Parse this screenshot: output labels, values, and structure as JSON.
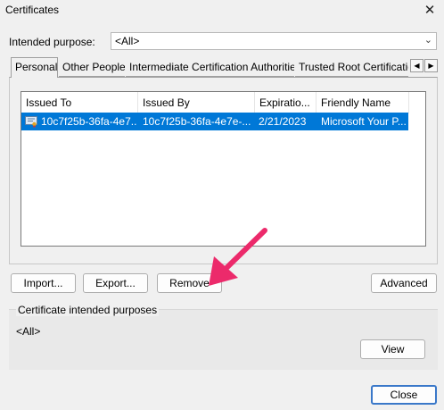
{
  "window": {
    "title": "Certificates",
    "close_glyph": "✕"
  },
  "purpose": {
    "label": "Intended purpose:",
    "value": "<All>"
  },
  "tabs": [
    {
      "label": "Personal",
      "active": true
    },
    {
      "label": "Other People",
      "active": false
    },
    {
      "label": "Intermediate Certification Authorities",
      "active": false
    },
    {
      "label": "Trusted Root Certification Authorities",
      "active": false
    }
  ],
  "table": {
    "columns": [
      "Issued To",
      "Issued By",
      "Expiratio...",
      "Friendly Name"
    ],
    "rows": [
      {
        "issued_to": "10c7f25b-36fa-4e7...",
        "issued_by": "10c7f25b-36fa-4e7e-...",
        "expiration": "2/21/2023",
        "friendly_name": "Microsoft Your P..."
      }
    ]
  },
  "buttons": {
    "import": "Import...",
    "export": "Export...",
    "remove": "Remove",
    "advanced": "Advanced",
    "view": "View",
    "close": "Close"
  },
  "purposes_group": {
    "title": "Certificate intended purposes",
    "value": "<All>"
  },
  "annotation": {
    "arrow_color": "#ec2a6b"
  },
  "colors": {
    "selection": "#0078d7",
    "dialog_bg": "#f0f0f0"
  }
}
